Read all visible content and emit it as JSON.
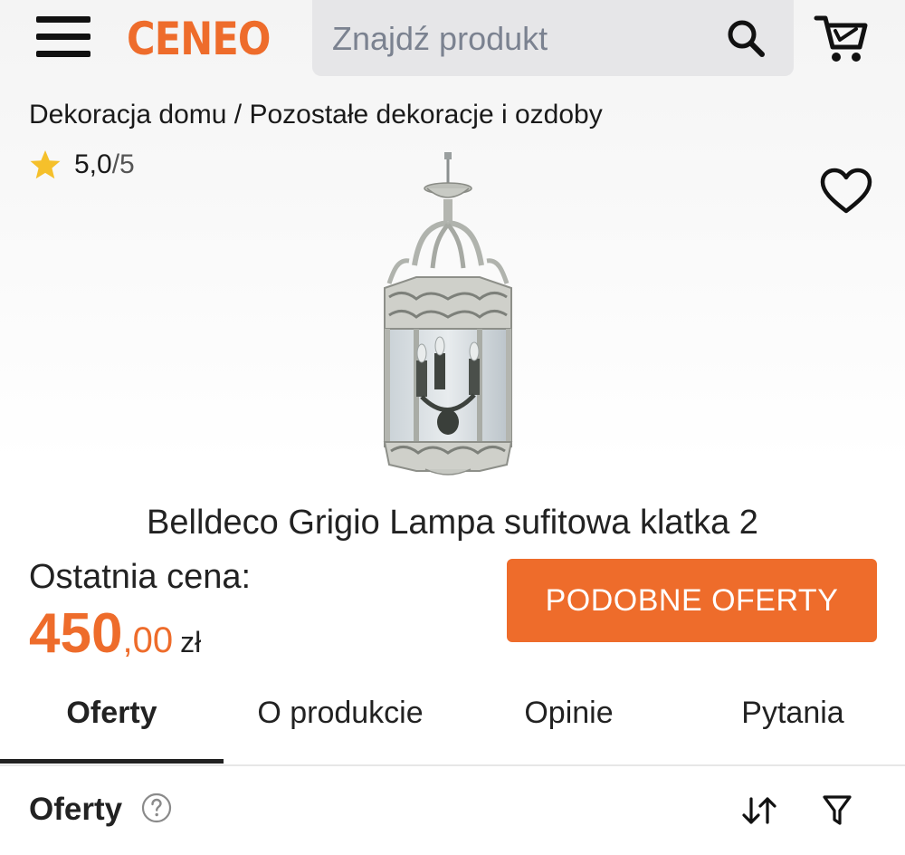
{
  "header": {
    "logo": "CENEO",
    "search_placeholder": "Znajdź produkt"
  },
  "breadcrumb": {
    "category": "Dekoracja domu",
    "separator": "/",
    "subcategory": "Pozostałe dekoracje i ozdoby"
  },
  "rating": {
    "score": "5,0",
    "max": "/5"
  },
  "product": {
    "title": "Belldeco Grigio Lampa sufitowa klatka 2",
    "price_label": "Ostatnia cena:",
    "price_main": "450",
    "price_cents": ",00",
    "price_currency": "zł"
  },
  "actions": {
    "similar_offers": "PODOBNE OFERTY"
  },
  "tabs": [
    {
      "label": "Oferty",
      "active": true
    },
    {
      "label": "O produkcie",
      "active": false
    },
    {
      "label": "Opinie",
      "active": false
    },
    {
      "label": "Pytania",
      "active": false
    }
  ],
  "offers": {
    "title": "Oferty"
  },
  "icons": {
    "menu": "hamburger-icon",
    "search": "search-icon",
    "cart": "cart-icon",
    "star": "star-icon",
    "favorite": "heart-icon",
    "help": "question-icon",
    "sort": "sort-icon",
    "filter": "filter-icon"
  },
  "colors": {
    "accent": "#ee6c2b",
    "star": "#f5c02b",
    "search_bg": "#e6e6e8"
  }
}
